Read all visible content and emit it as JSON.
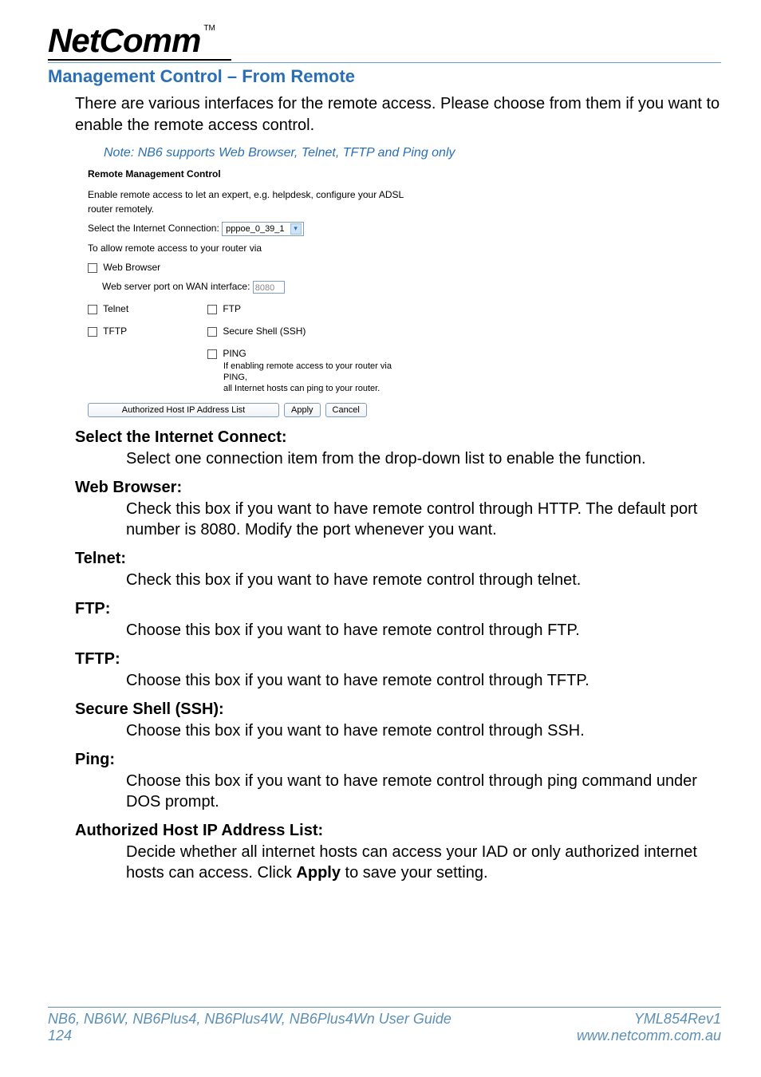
{
  "header": {
    "logo": "NetComm",
    "tm": "TM"
  },
  "title": "Management Control – From Remote",
  "intro": "There are various interfaces for the remote access. Please choose from them if you want to enable the remote access control.",
  "note": "Note: NB6 supports Web Browser, Telnet, TFTP and Ping only",
  "panel": {
    "heading": "Remote Management Control",
    "enable_text": "Enable remote access to let an expert, e.g. helpdesk, configure your ADSL router remotely.",
    "select_conn_label": "Select the Internet Connection:",
    "select_conn_value": "pppoe_0_39_1",
    "allow_text": "To allow remote access to your router via",
    "web_browser": "Web Browser",
    "web_port_label": "Web server port on WAN interface:",
    "web_port_value": "8080",
    "telnet": "Telnet",
    "ftp": "FTP",
    "tftp": "TFTP",
    "ssh": "Secure Shell (SSH)",
    "ping": "PING",
    "ping_note1": "If enabling remote access to your router via PING,",
    "ping_note2": "all Internet hosts can ping to your router.",
    "btn_authorized": "Authorized Host IP Address List",
    "btn_apply": "Apply",
    "btn_cancel": "Cancel"
  },
  "defs": {
    "sel_title": "Select the Internet Connect:",
    "sel_body": "Select one connection item from the drop-down list to enable the function.",
    "web_title": "Web Browser:",
    "web_body": "Check this box if you want to have remote control through HTTP. The default port number is 8080. Modify the port whenever you want.",
    "telnet_title": "Telnet:",
    "telnet_body": "Check this box if you want to have remote control through telnet.",
    "ftp_title": "FTP:",
    "ftp_body": "Choose this box if you want to have remote control through FTP.",
    "tftp_title": "TFTP:",
    "tftp_body": "Choose this box if you want to have remote control through TFTP.",
    "ssh_title": "Secure Shell (SSH):",
    "ssh_body": "Choose this box if you want to have remote control through SSH.",
    "ping_title": "Ping:",
    "ping_body": "Choose this box if you want to have remote control through ping command under DOS prompt.",
    "auth_title": "Authorized Host IP Address List:",
    "auth_body_pre": "Decide whether all internet hosts can access your IAD or only authorized internet hosts can access. Click ",
    "auth_body_b": "Apply",
    "auth_body_post": " to save your setting."
  },
  "footer": {
    "left1": "NB6, NB6W, NB6Plus4, NB6Plus4W, NB6Plus4Wn User Guide",
    "left2": "124",
    "right1": "YML854Rev1",
    "right2": "www.netcomm.com.au"
  }
}
